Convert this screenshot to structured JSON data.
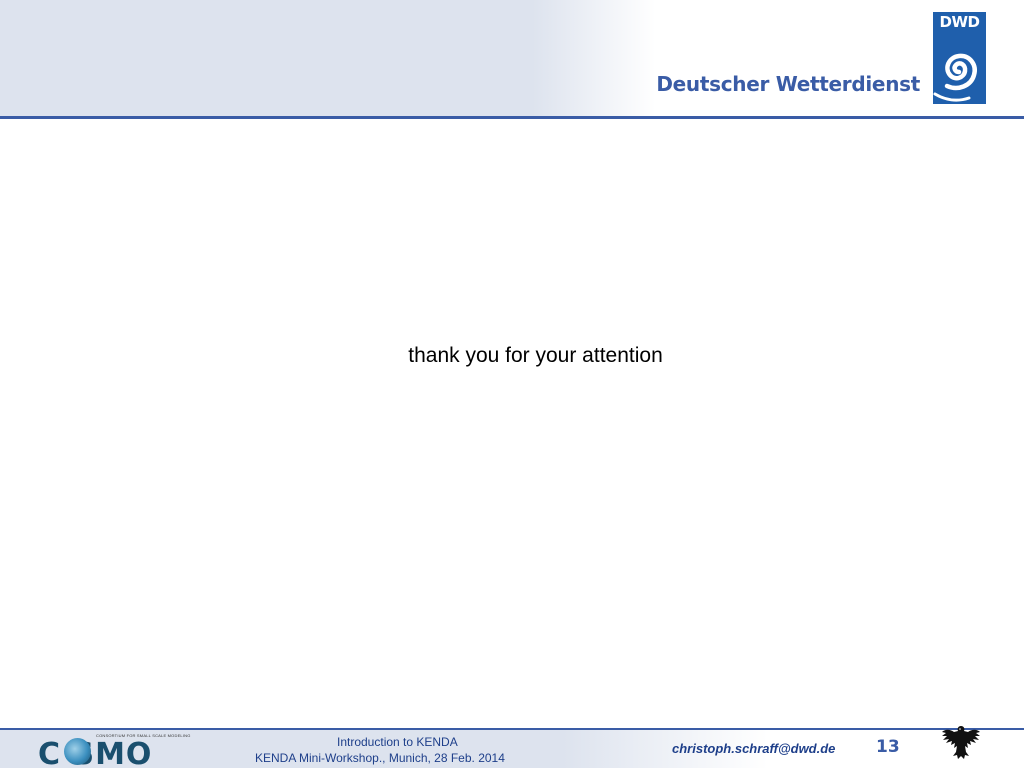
{
  "header": {
    "org_name": "Deutscher Wetterdienst",
    "logo_text": "DWD"
  },
  "main": {
    "text": "thank you for your attention"
  },
  "footer": {
    "line1": "Introduction to KENDA",
    "line2": "KENDA Mini-Workshop.,  Munich,  28 Feb. 2014",
    "email": "christoph.schraff@dwd.de",
    "page_number": "13",
    "cosmo_letters": "C  SMO",
    "cosmo_tagline": "CONSORTIUM FOR SMALL SCALE MODELING"
  },
  "colors": {
    "accent": "#3a5ca6",
    "logo_blue": "#1f5fac",
    "footer_text": "#1e3f8a"
  }
}
